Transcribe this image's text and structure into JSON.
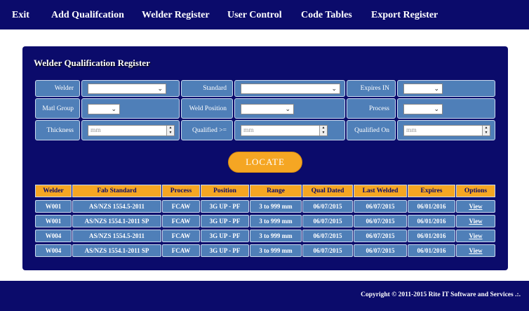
{
  "nav": {
    "exit": "Exit",
    "add_qualification": "Add Qualifcation",
    "welder_register": "Welder Register",
    "user_control": "User Control",
    "code_tables": "Code Tables",
    "export_register": "Export Register"
  },
  "panel": {
    "title": "Welder Qualification Register"
  },
  "filters": {
    "welder": "Welder",
    "standard": "Standard",
    "expires_in": "Expires IN",
    "matl_group": "Matl Group",
    "weld_position": "Weld Position",
    "process": "Process",
    "thickness": "Thickness",
    "thickness_placeholder": "mm",
    "qualified_gte": "Qualified >=",
    "qualified_gte_placeholder": "mm",
    "qualified_on": "Qualified On",
    "qualified_on_placeholder": "mm"
  },
  "locate_button": "LOCATE",
  "table": {
    "headers": [
      "Welder",
      "Fab Standard",
      "Process",
      "Position",
      "Range",
      "Qual Dated",
      "Last Welded",
      "Expires",
      "Options"
    ],
    "rows": [
      [
        "W001",
        "AS/NZS 1554.5-2011",
        "FCAW",
        "3G UP - PF",
        "3 to 999 mm",
        "06/07/2015",
        "06/07/2015",
        "06/01/2016",
        "View"
      ],
      [
        "W001",
        "AS/NZS 1554.1-2011 SP",
        "FCAW",
        "3G UP - PF",
        "3 to 999 mm",
        "06/07/2015",
        "06/07/2015",
        "06/01/2016",
        "View"
      ],
      [
        "W004",
        "AS/NZS 1554.5-2011",
        "FCAW",
        "3G UP - PF",
        "3 to 999 mm",
        "06/07/2015",
        "06/07/2015",
        "06/01/2016",
        "View"
      ],
      [
        "W004",
        "AS/NZS 1554.1-2011 SP",
        "FCAW",
        "3G UP - PF",
        "3 to 999 mm",
        "06/07/2015",
        "06/07/2015",
        "06/01/2016",
        "View"
      ]
    ]
  },
  "footer": {
    "copyright": "Copyright © 2011-2015 Rite IT Software and Services .:."
  },
  "colors": {
    "navy": "#0b0b6b",
    "accent": "#f5a623",
    "cell": "#4f7fb8"
  }
}
